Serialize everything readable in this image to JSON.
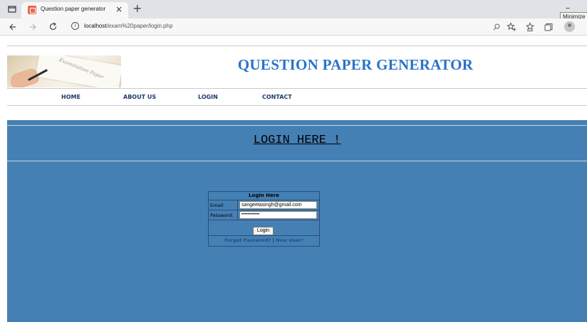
{
  "browser": {
    "tab_title": "Question paper generator",
    "tab_close": "×",
    "new_tab": "+",
    "minimize_glyph": "–",
    "tooltip": "Minimize",
    "url_host": "localhost",
    "url_path": "/exam%20paper/login.php",
    "icons": [
      "tab-actions-icon",
      "favicon-icon",
      "back-icon",
      "forward-icon",
      "reload-icon",
      "site-info-icon",
      "read-aloud-icon",
      "add-favorite-icon",
      "favorites-icon",
      "collections-icon",
      "profile-icon"
    ]
  },
  "header": {
    "site_title": "QUESTION PAPER GENERATOR",
    "banner_image_text": "Examination Paper"
  },
  "nav": {
    "items": [
      {
        "label": "HOME"
      },
      {
        "label": "ABOUT US"
      },
      {
        "label": "LOGIN"
      },
      {
        "label": "CONTACT"
      }
    ]
  },
  "main": {
    "heading": "LOGIN HERE !",
    "panel_color": "#4580b4"
  },
  "login_form": {
    "title": "Login Here",
    "email_label": "Email:",
    "email_value": "sangeetasingh@gmail.com",
    "password_label": "Password:",
    "password_value": "••••••••••••",
    "submit_label": "Login",
    "forgot_link": "Forgot Password?",
    "separator": "|",
    "new_user_link": "New User?"
  },
  "colors": {
    "title_blue": "#2a73c9",
    "nav_text": "#1e3a6b",
    "link_blue": "#1f4f86"
  }
}
